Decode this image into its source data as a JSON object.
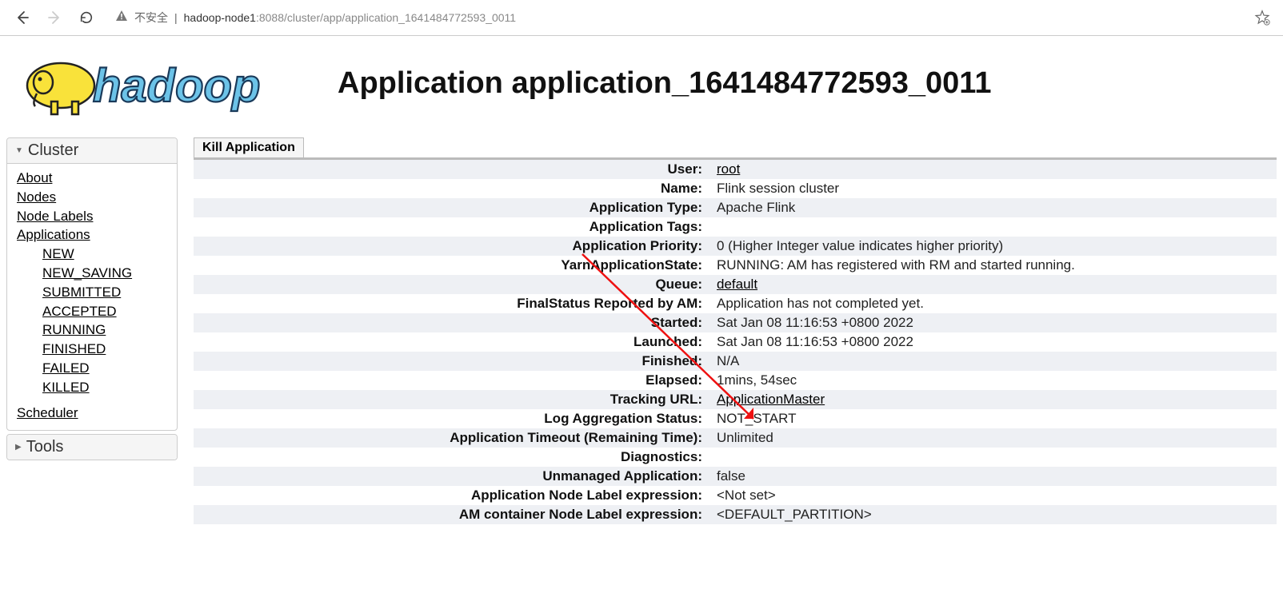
{
  "browser": {
    "security_text": "不安全",
    "url_host": "hadoop-node1",
    "url_path": ":8088/cluster/app/application_1641484772593_0011"
  },
  "page_title": "Application application_1641484772593_0011",
  "kill_label": "Kill Application",
  "sidebar": {
    "cluster_header": "Cluster",
    "tools_header": "Tools",
    "about": "About",
    "nodes": "Nodes",
    "node_labels": "Node Labels",
    "applications": "Applications",
    "app_new": "NEW",
    "app_new_saving": "NEW_SAVING",
    "app_submitted": "SUBMITTED",
    "app_accepted": "ACCEPTED",
    "app_running": "RUNNING",
    "app_finished": "FINISHED",
    "app_failed": "FAILED",
    "app_killed": "KILLED",
    "scheduler": "Scheduler"
  },
  "rows": [
    {
      "label": "User:",
      "value": "root",
      "link": true
    },
    {
      "label": "Name:",
      "value": "Flink session cluster",
      "link": false
    },
    {
      "label": "Application Type:",
      "value": "Apache Flink",
      "link": false
    },
    {
      "label": "Application Tags:",
      "value": "",
      "link": false
    },
    {
      "label": "Application Priority:",
      "value": "0 (Higher Integer value indicates higher priority)",
      "link": false
    },
    {
      "label": "YarnApplicationState:",
      "value": "RUNNING: AM has registered with RM and started running.",
      "link": false
    },
    {
      "label": "Queue:",
      "value": "default",
      "link": true
    },
    {
      "label": "FinalStatus Reported by AM:",
      "value": "Application has not completed yet.",
      "link": false
    },
    {
      "label": "Started:",
      "value": "Sat Jan 08 11:16:53 +0800 2022",
      "link": false
    },
    {
      "label": "Launched:",
      "value": "Sat Jan 08 11:16:53 +0800 2022",
      "link": false
    },
    {
      "label": "Finished:",
      "value": "N/A",
      "link": false
    },
    {
      "label": "Elapsed:",
      "value": "1mins, 54sec",
      "link": false
    },
    {
      "label": "Tracking URL:",
      "value": "ApplicationMaster",
      "link": true
    },
    {
      "label": "Log Aggregation Status:",
      "value": "NOT_START",
      "link": false
    },
    {
      "label": "Application Timeout (Remaining Time):",
      "value": "Unlimited",
      "link": false
    },
    {
      "label": "Diagnostics:",
      "value": "",
      "link": false
    },
    {
      "label": "Unmanaged Application:",
      "value": "false",
      "link": false
    },
    {
      "label": "Application Node Label expression:",
      "value": "<Not set>",
      "link": false
    },
    {
      "label": "AM container Node Label expression:",
      "value": "<DEFAULT_PARTITION>",
      "link": false
    }
  ]
}
